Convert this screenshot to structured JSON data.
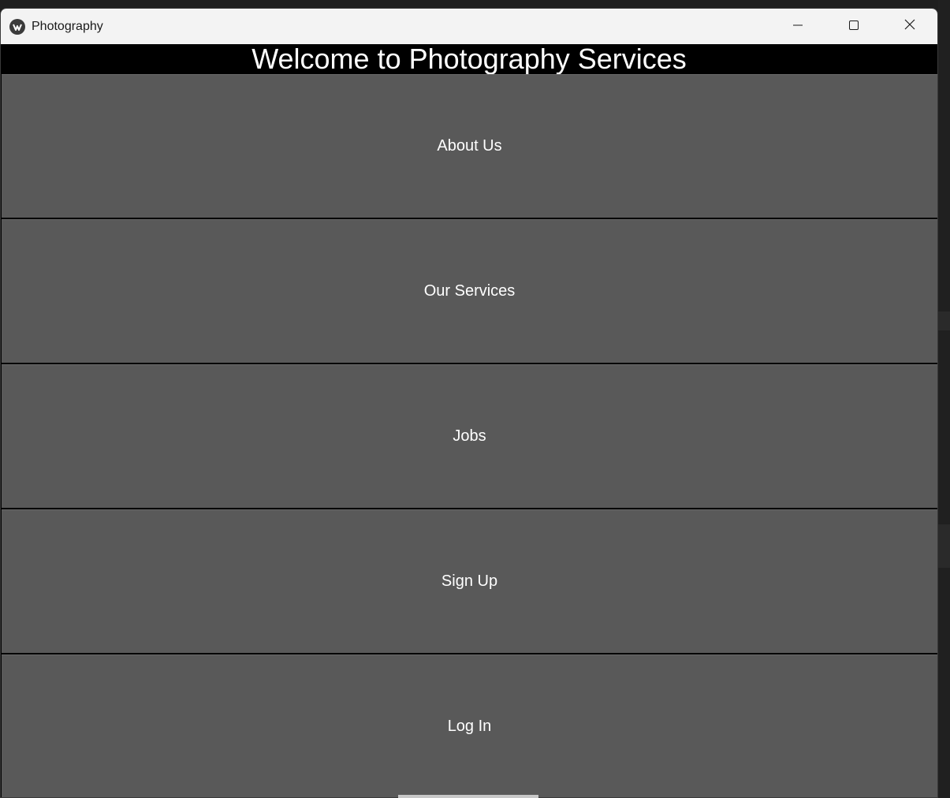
{
  "window": {
    "title": "Photography",
    "controls": {
      "minimize": "minimize-icon",
      "maximize": "maximize-icon",
      "close": "close-icon"
    }
  },
  "header": {
    "title": "Welcome to Photography Services"
  },
  "menu": {
    "items": [
      {
        "label": "About Us"
      },
      {
        "label": "Our Services"
      },
      {
        "label": "Jobs"
      },
      {
        "label": "Sign Up"
      },
      {
        "label": "Log In"
      }
    ]
  },
  "colors": {
    "button_bg": "#595959",
    "header_bg": "#000000",
    "titlebar_bg": "#f3f3f3",
    "text": "#ffffff"
  }
}
